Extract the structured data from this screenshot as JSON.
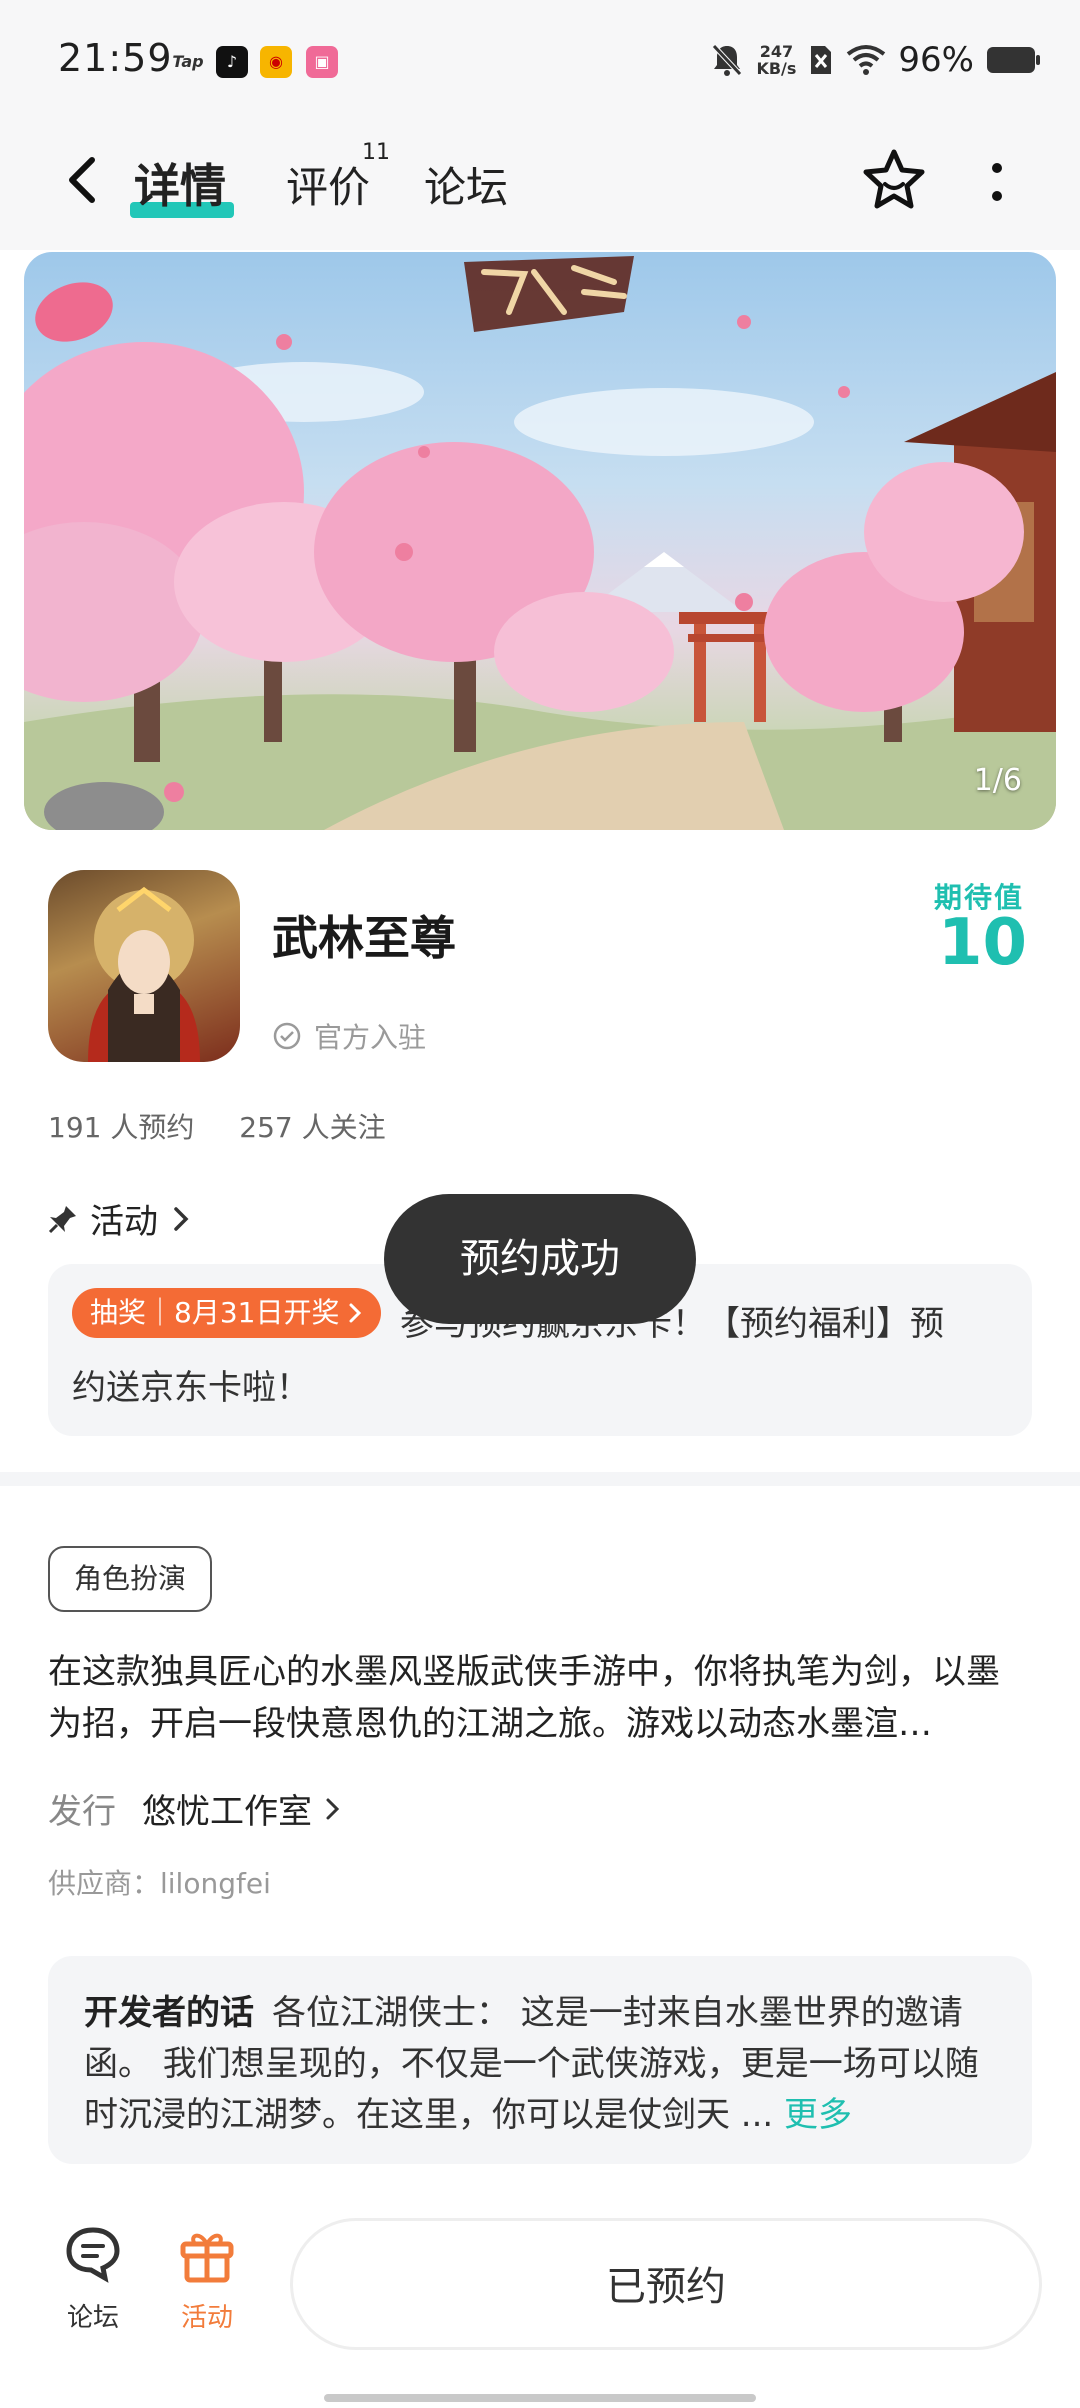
{
  "status_bar": {
    "time": "21:59",
    "apps": [
      "Tap",
      "tiktok-icon",
      "weibo-icon",
      "bilibili-icon"
    ],
    "net_speed_value": "247",
    "net_speed_unit": "KB/s",
    "battery": "96%"
  },
  "nav": {
    "tabs": [
      {
        "label": "详情",
        "active": true
      },
      {
        "label": "评价",
        "badge": "11"
      },
      {
        "label": "论坛"
      }
    ]
  },
  "banner": {
    "counter": "1/6"
  },
  "game": {
    "title": "武林至尊",
    "official": "官方入驻",
    "expect_label": "期待值",
    "expect_value": "10",
    "reservations": "191 人预约",
    "followers": "257 人关注"
  },
  "activity": {
    "header": "活动",
    "tag": "抽奖｜8月31日开奖",
    "text_line1": "参与预约赢京东卡！【预约福利】预",
    "text_line2": "约送京东卡啦！"
  },
  "toast": "预约成功",
  "details": {
    "genre": "角色扮演",
    "description": "在这款独具匠心的水墨风竖版武侠手游中，你将执笔为剑，以墨为招，开启一段快意恩仇的江湖之旅。游戏以动态水墨渲…",
    "publisher_label": "发行",
    "publisher_name": "悠忧工作室",
    "supplier": "供应商：lilongfei"
  },
  "developer": {
    "label": "开发者的话",
    "text": "各位江湖侠士： 这是一封来自水墨世界的邀请函。 我们想呈现的，不仅是一个武侠游戏，更是一场可以随时沉浸的江湖梦。在这里，你可以是仗剑天 ...",
    "more": "更多"
  },
  "bottom": {
    "forum": "论坛",
    "activity": "活动",
    "reserve_button": "已预约"
  },
  "colors": {
    "accent": "#1fbfb0",
    "tab_underline": "#22c7b8",
    "lottery": "#f46b35",
    "activity_bottom": "#f27c3b"
  }
}
